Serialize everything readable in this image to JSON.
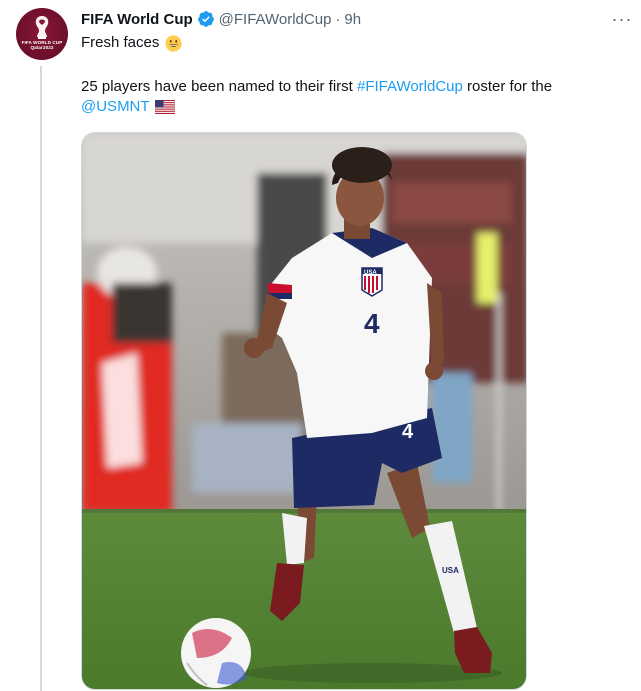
{
  "tweet": {
    "display_name": "FIFA World Cup",
    "handle": "@FIFAWorldCup",
    "separator": "·",
    "time": "9h",
    "more_label": "···",
    "avatar_text": "FIFA WORLD CUP Qatar2022",
    "text": {
      "line1": "Fresh faces",
      "line2_prefix": "25 players have been named to their first ",
      "hashtag": "#FIFAWorldCup",
      "line2_suffix": " roster for the",
      "mention": "@USMNT"
    },
    "media": {
      "jersey_number": "4",
      "crest_text": "USA",
      "sock_text": "USA"
    }
  },
  "colors": {
    "link": "#1d9bf0",
    "secondary_text": "#536471",
    "verified": "#1d9bf0",
    "avatar_bg": "#8a1538"
  },
  "icons": {
    "verified": "verified-badge-icon",
    "more": "more-options-icon",
    "emoji": "grinning-face-emoji-icon",
    "flag": "us-flag-emoji-icon"
  }
}
